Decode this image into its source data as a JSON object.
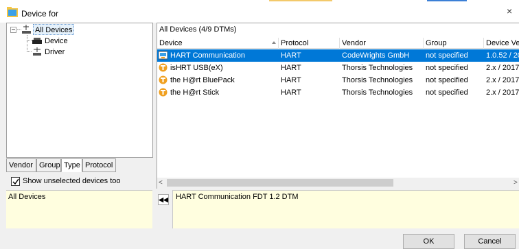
{
  "window": {
    "title": "Device for",
    "close_glyph": "×",
    "icon": "folder-icon"
  },
  "tree": {
    "root": {
      "label": "All Devices",
      "icon": "all-devices-icon"
    },
    "children": [
      {
        "label": "Device",
        "icon": "device-icon"
      },
      {
        "label": "Driver",
        "icon": "driver-icon"
      }
    ]
  },
  "tabs": [
    "Vendor",
    "Group",
    "Type",
    "Protocol"
  ],
  "active_tab": "Type",
  "show_unselected": {
    "label": "Show unselected devices too",
    "checked": true
  },
  "left_info": {
    "text": "All Devices"
  },
  "grid": {
    "group_header": "All Devices (4/9 DTMs)",
    "columns": [
      "Device",
      "Protocol",
      "Vendor",
      "Group",
      "Device Ver"
    ],
    "rows": [
      {
        "device": "HART Communication",
        "protocol": "HART",
        "vendor": "CodeWrights GmbH",
        "group": "not specified",
        "version": "1.0.52 / 20",
        "icon": "hart-communication-icon",
        "selected": true
      },
      {
        "device": "isHRT USB(eX)",
        "protocol": "HART",
        "vendor": "Thorsis Technologies",
        "group": "not specified",
        "version": "2.x / 2017",
        "icon": "thorsis-dtm-icon",
        "selected": false
      },
      {
        "device": "the H@rt BluePack",
        "protocol": "HART",
        "vendor": "Thorsis Technologies",
        "group": "not specified",
        "version": "2.x / 2017",
        "icon": "thorsis-dtm-icon",
        "selected": false
      },
      {
        "device": "the H@rt Stick",
        "protocol": "HART",
        "vendor": "Thorsis Technologies",
        "group": "not specified",
        "version": "2.x / 2017",
        "icon": "thorsis-dtm-icon",
        "selected": false
      }
    ]
  },
  "scrollbar": {
    "left_glyph": "<",
    "right_glyph": ">"
  },
  "right_info": {
    "text": "HART Communication FDT 1.2 DTM",
    "collapse_glyph": "◀◀"
  },
  "buttons": {
    "ok": "OK",
    "cancel": "Cancel"
  },
  "colors": {
    "selection": "#0078d7",
    "info_background": "#fffedf",
    "icon_orange": "#f0a020"
  }
}
